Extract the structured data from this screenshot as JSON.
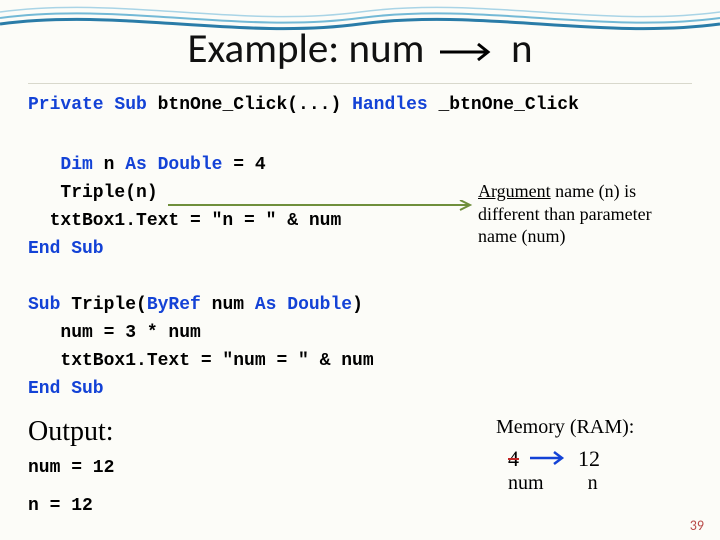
{
  "title": {
    "left": "Example: num",
    "right": "n"
  },
  "code": {
    "line1_pre": "Private Sub",
    "line1_mid": " btnOne_Click(...) ",
    "line1_kw2": "Handles",
    "line1_post": " _btnOne_Click",
    "b1_l1a": "   Dim",
    "b1_l1b": " n ",
    "b1_l1c": "As Double",
    "b1_l1d": " = 4",
    "b1_l2": "   Triple(n)",
    "b1_l3": "  txtBox1.Text = \"n = \" & num",
    "b1_l4": "End Sub",
    "b2_l1a": "Sub",
    "b2_l1b": " Triple(",
    "b2_l1c": "ByRef",
    "b2_l1d": " num ",
    "b2_l1e": "As Double",
    "b2_l1f": ")",
    "b2_l2": "   num = 3 * num",
    "b2_l3": "   txtBox1.Text = \"num = \" & num",
    "b2_l4": "End Sub"
  },
  "callout": {
    "l1a": "Argument",
    "l1b": " name (n) is",
    "l2": "different than parameter",
    "l3": "name (num)"
  },
  "output": {
    "heading": "Output:",
    "line1": "num = 12",
    "line2": "n = 12"
  },
  "memory": {
    "heading": "Memory (RAM):",
    "val_old": "4",
    "val_new": "12",
    "lbl_left": "num",
    "lbl_right": "n"
  },
  "page": "39"
}
